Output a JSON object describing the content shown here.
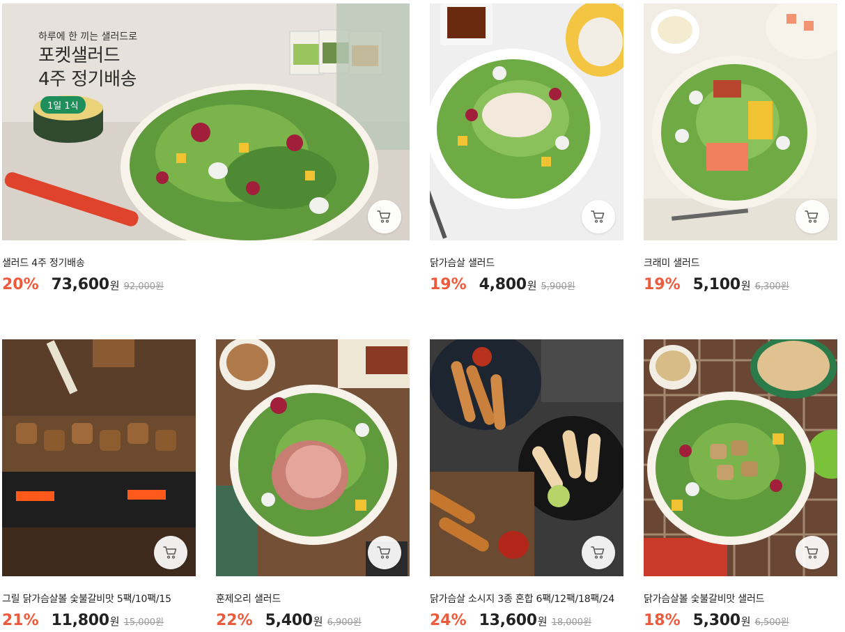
{
  "banner": {
    "subtitle": "하루에 한 끼는 샐러드로",
    "title_line1": "포켓샐러드",
    "title_line2": "4주 정기배송",
    "badge": "1일 1식"
  },
  "products": [
    {
      "title": "샐러드 4주 정기배송",
      "discount": "20%",
      "price": "73,600",
      "currency": "원",
      "original": "92,000원"
    },
    {
      "title": "닭가슴살 샐러드",
      "discount": "19%",
      "price": "4,800",
      "currency": "원",
      "original": "5,900원"
    },
    {
      "title": "크래미 샐러드",
      "discount": "19%",
      "price": "5,100",
      "currency": "원",
      "original": "6,300원"
    },
    {
      "title": "그릴 닭가슴살볼 숯불갈비맛 5팩/10팩/15",
      "discount": "21%",
      "price": "11,800",
      "currency": "원",
      "original": "15,000원"
    },
    {
      "title": "훈제오리 샐러드",
      "discount": "22%",
      "price": "5,400",
      "currency": "원",
      "original": "6,900원"
    },
    {
      "title": "닭가슴살 소시지 3종 혼합 6팩/12팩/18팩/24",
      "discount": "24%",
      "price": "13,600",
      "currency": "원",
      "original": "18,000원"
    },
    {
      "title": "닭가슴살볼 숯불갈비맛 샐러드",
      "discount": "18%",
      "price": "5,300",
      "currency": "원",
      "original": "6,500원"
    }
  ],
  "icons": {
    "cart": "cart-icon"
  },
  "colors": {
    "discount": "#ee5a3c",
    "badge": "#1e8e5a"
  }
}
